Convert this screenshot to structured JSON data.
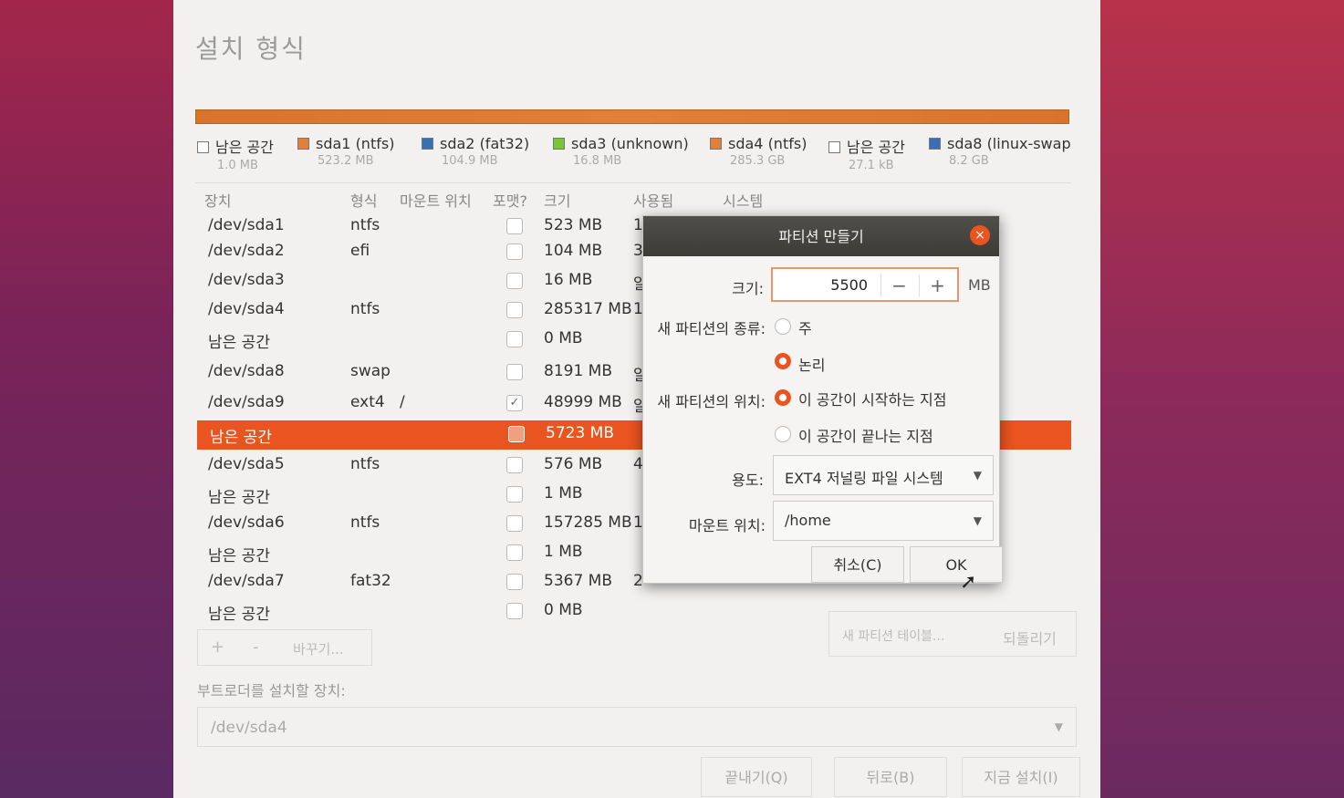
{
  "window": {
    "title": "설치 형식"
  },
  "legend": [
    {
      "label": "남은 공간",
      "size": "1.0 MB",
      "color": "#ffffff"
    },
    {
      "label": "sda1 (ntfs)",
      "size": "523.2 MB",
      "color": "#e0803a"
    },
    {
      "label": "sda2 (fat32)",
      "size": "104.9 MB",
      "color": "#3a6fb5"
    },
    {
      "label": "sda3 (unknown)",
      "size": "16.8 MB",
      "color": "#7ac43a"
    },
    {
      "label": "sda4 (ntfs)",
      "size": "285.3 GB",
      "color": "#e0803a"
    },
    {
      "label": "남은 공간",
      "size": "27.1 kB",
      "color": "#ffffff"
    },
    {
      "label": "sda8 (linux-swap",
      "size": "8.2 GB",
      "color": "#3a6fb5"
    }
  ],
  "table": {
    "headers": {
      "device": "장치",
      "type": "형식",
      "mount": "마운트 위치",
      "format": "포맷?",
      "size": "크기",
      "used": "사용됨",
      "system": "시스템"
    },
    "rows": [
      {
        "device": "/dev/sda1",
        "type": "ntfs",
        "mount": "",
        "size": "523 MB",
        "used": "1"
      },
      {
        "device": "/dev/sda2",
        "type": "efi",
        "mount": "",
        "size": "104 MB",
        "used": "3"
      },
      {
        "device": "/dev/sda3",
        "type": "",
        "mount": "",
        "size": "16 MB",
        "used": "알"
      },
      {
        "device": "/dev/sda4",
        "type": "ntfs",
        "mount": "",
        "size": "285317 MB",
        "used": "1"
      },
      {
        "device": "남은 공간",
        "type": "",
        "mount": "",
        "size": "0 MB",
        "used": ""
      },
      {
        "device": "/dev/sda8",
        "type": "swap",
        "mount": "",
        "size": "8191 MB",
        "used": "알"
      },
      {
        "device": "/dev/sda9",
        "type": "ext4",
        "mount": "/",
        "size": "48999 MB",
        "used": "알"
      },
      {
        "device": "남은 공간",
        "type": "",
        "mount": "",
        "size": "5723 MB",
        "used": ""
      },
      {
        "device": "/dev/sda5",
        "type": "ntfs",
        "mount": "",
        "size": "576 MB",
        "used": "4"
      },
      {
        "device": "남은 공간",
        "type": "",
        "mount": "",
        "size": "1 MB",
        "used": ""
      },
      {
        "device": "/dev/sda6",
        "type": "ntfs",
        "mount": "",
        "size": "157285 MB",
        "used": "1"
      },
      {
        "device": "남은 공간",
        "type": "",
        "mount": "",
        "size": "1 MB",
        "used": ""
      },
      {
        "device": "/dev/sda7",
        "type": "fat32",
        "mount": "",
        "size": "5367 MB",
        "used": "2"
      },
      {
        "device": "남은 공간",
        "type": "",
        "mount": "",
        "size": "0 MB",
        "used": ""
      }
    ],
    "add_label": "+",
    "remove_label": "-",
    "change_label": "바꾸기...",
    "new_table_label": "새 파티션 테이블...",
    "revert_label": "되돌리기"
  },
  "bootloader": {
    "label": "부트로더를 설치할 장치:",
    "value": "/dev/sda4"
  },
  "footer": {
    "quit": "끝내기(Q)",
    "back": "뒤로(B)",
    "install": "지금 설치(I)"
  },
  "dialog": {
    "title": "파티션 만들기",
    "close_icon": "×",
    "size_label": "크기:",
    "size_value": "5500",
    "size_unit": "MB",
    "minus": "−",
    "plus": "+",
    "type_label": "새 파티션의 종류:",
    "type_primary": "주",
    "type_logical": "논리",
    "location_label": "새 파티션의 위치:",
    "location_begin": "이 공간이 시작하는 지점",
    "location_end": "이 공간이 끝나는 지점",
    "use_label": "용도:",
    "use_value": "EXT4 저널링 파일 시스템",
    "mount_label": "마운트 위치:",
    "mount_value": "/home",
    "cancel": "취소(C)",
    "ok": "OK"
  }
}
